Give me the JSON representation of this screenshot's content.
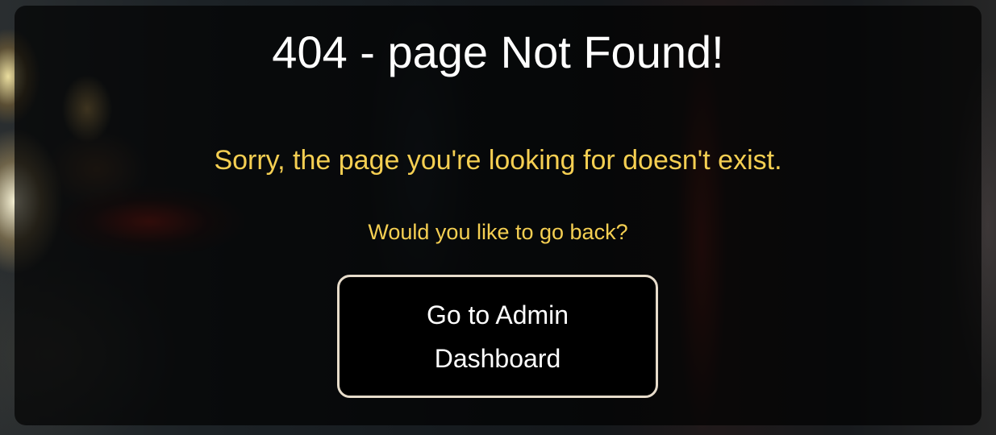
{
  "error": {
    "title": "404 - page Not Found!",
    "message": "Sorry, the page you're looking for doesn't exist.",
    "prompt": "Would you like to go back?"
  },
  "actions": {
    "dashboard_button_label": "Go to Admin Dashboard"
  },
  "colors": {
    "title": "#ffffff",
    "accent_text": "#f5cf52",
    "button_background": "#000000",
    "button_border": "#e7dccb"
  }
}
